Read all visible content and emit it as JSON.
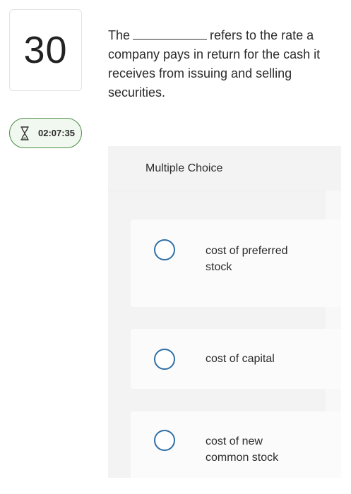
{
  "question": {
    "number": "30",
    "text_before": "The",
    "text_after": "refers to the rate a company pays in return for the cash it receives from issuing and selling securities."
  },
  "timer": {
    "icon": "hourglass-icon",
    "value": "02:07:35",
    "accent_color": "#4a8d43"
  },
  "multiple_choice": {
    "header": "Multiple Choice",
    "options": [
      {
        "label": "cost of preferred stock"
      },
      {
        "label": "cost of capital"
      },
      {
        "label": "cost of new common stock"
      }
    ]
  },
  "colors": {
    "radio_border": "#2f6fa6",
    "panel_bg": "#f3f3f3"
  }
}
